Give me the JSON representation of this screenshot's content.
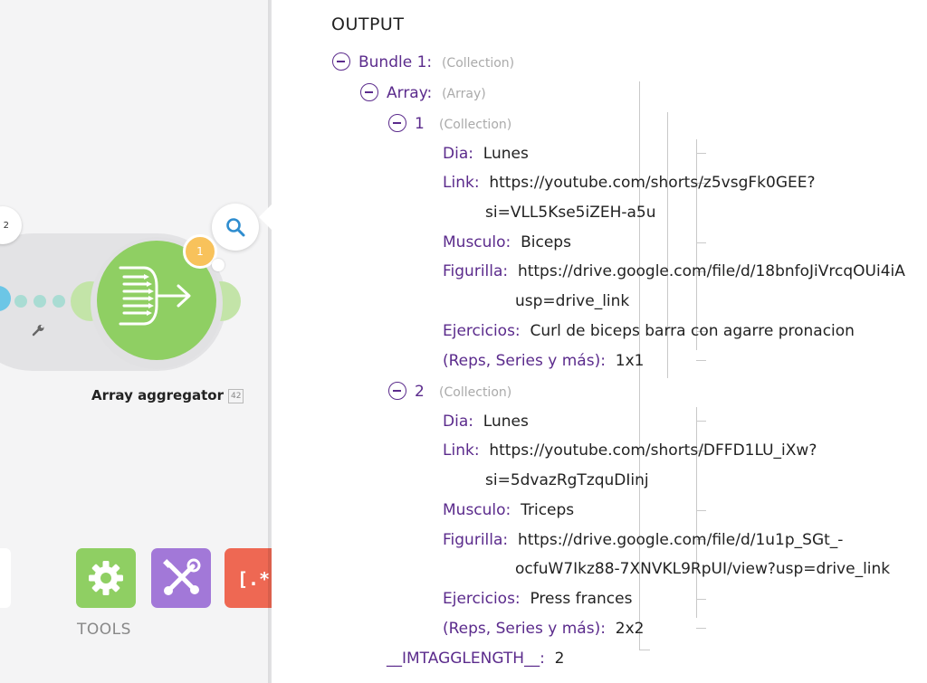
{
  "canvas": {
    "route_badge_count": "2",
    "module": {
      "title": "Array aggregator",
      "id": "42",
      "operations_count": "1"
    },
    "tools_label": "TOOLS",
    "colors": {
      "module_green": "#8fcf63",
      "settings_tool": "#8fcf63",
      "tools_tool": "#a278d8",
      "text_tool": "#ee6853",
      "operation_badge": "#f8c25b"
    }
  },
  "panel": {
    "title": "OUTPUT",
    "bundle": {
      "label": "Bundle 1:",
      "type": "(Collection)",
      "array": {
        "label": "Array:",
        "type": "(Array)",
        "items": [
          {
            "label": "1",
            "type": "(Collection)",
            "fields": {
              "dia_key": "Dia:",
              "dia_val": "Lunes",
              "link_key": "Link:",
              "link_val_1": "https://youtube.com/shorts/z5vsgFk0GEE?",
              "link_val_2": "si=VLL5Kse5iZEH-a5u",
              "musculo_key": "Musculo:",
              "musculo_val": "Biceps",
              "figurilla_key": "Figurilla:",
              "figurilla_val_1": "https://drive.google.com/file/d/18bnfoJiVrcqOUi4iA",
              "figurilla_val_2": "usp=drive_link",
              "ejercicios_key": "Ejercicios:",
              "ejercicios_val": "Curl de biceps barra con agarre pronacion",
              "reps_key": "(Reps, Series y más):",
              "reps_val": "1x1"
            }
          },
          {
            "label": "2",
            "type": "(Collection)",
            "fields": {
              "dia_key": "Dia:",
              "dia_val": "Lunes",
              "link_key": "Link:",
              "link_val_1": "https://youtube.com/shorts/DFFD1LU_iXw?",
              "link_val_2": "si=5dvazRgTzquDIinj",
              "musculo_key": "Musculo:",
              "musculo_val": "Triceps",
              "figurilla_key": "Figurilla:",
              "figurilla_val_1": "https://drive.google.com/file/d/1u1p_SGt_-",
              "figurilla_val_2": "ocfuW7Ikz88-7XNVKL9RpUI/view?usp=drive_link",
              "ejercicios_key": "Ejercicios:",
              "ejercicios_val": "Press frances",
              "reps_key": "(Reps, Series y más):",
              "reps_val": "2x2"
            }
          }
        ]
      },
      "length_key": "__IMTAGGLENGTH__:",
      "length_val": "2"
    }
  }
}
